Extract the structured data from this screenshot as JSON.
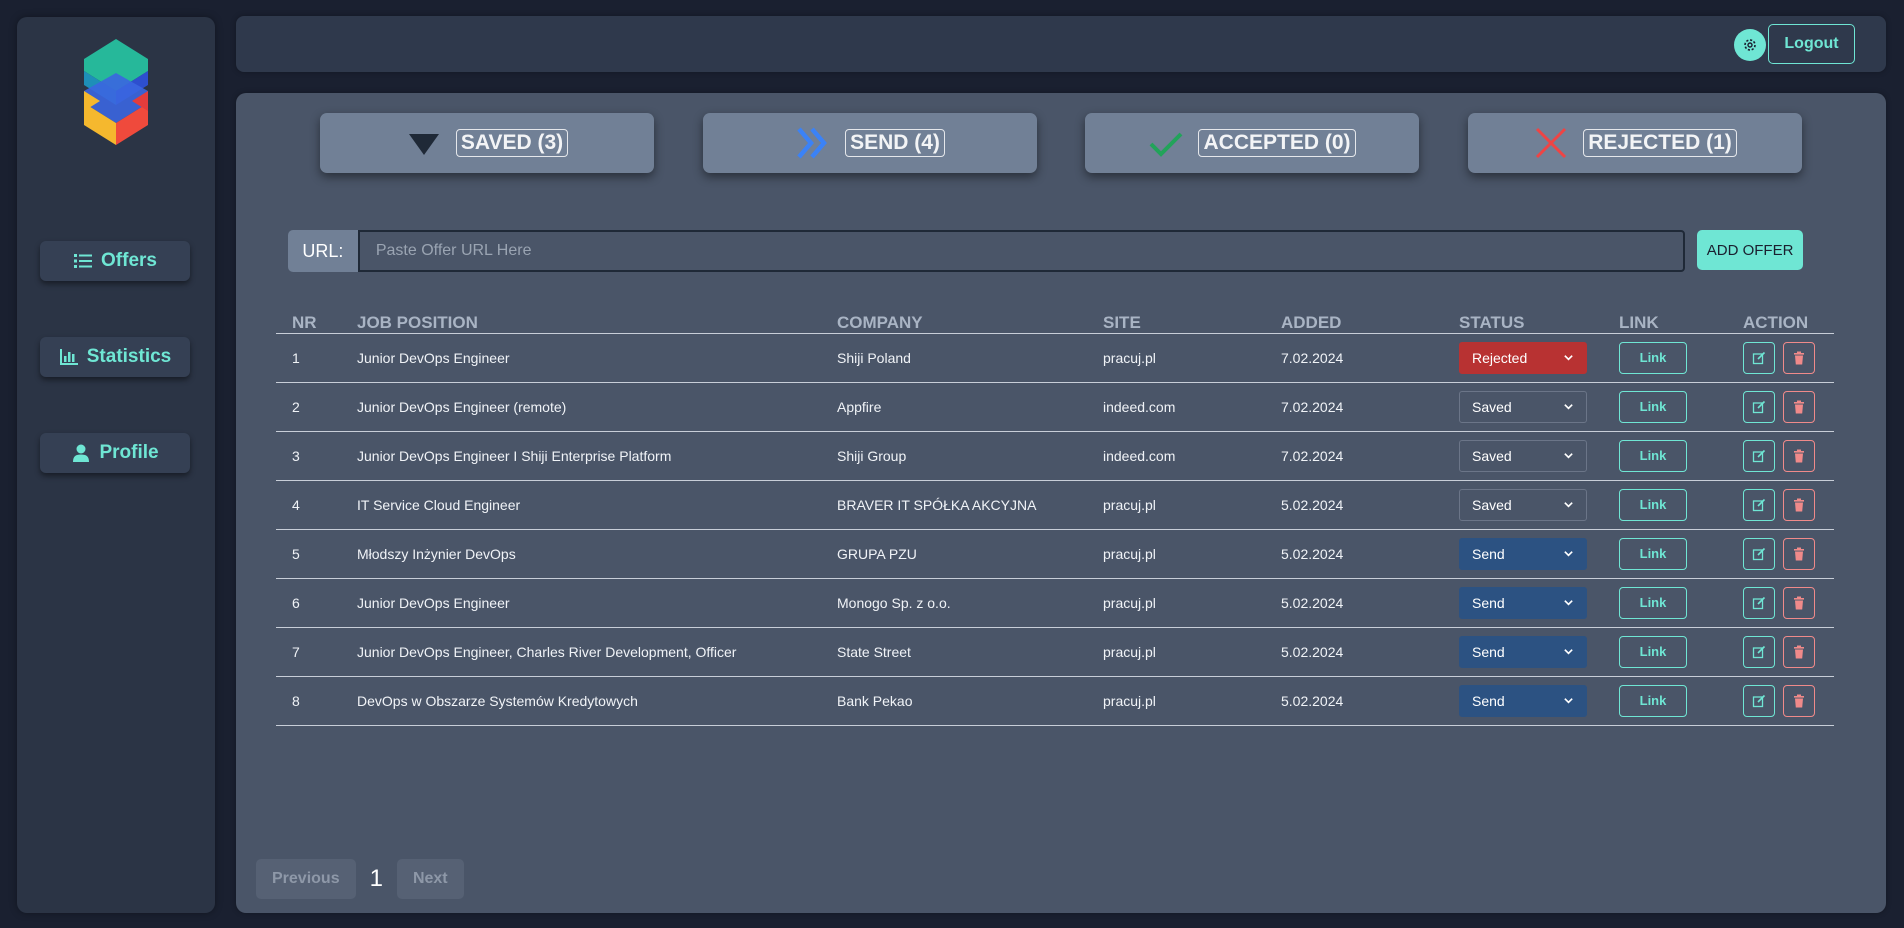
{
  "sidebar": {
    "items": [
      {
        "label": "Offers",
        "icon": "list-icon"
      },
      {
        "label": "Statistics",
        "icon": "bar-chart-icon"
      },
      {
        "label": "Profile",
        "icon": "user-icon"
      }
    ]
  },
  "header": {
    "logout_label": "Logout",
    "settings_icon": "gear-icon"
  },
  "stats": [
    {
      "label": "SAVED (3)",
      "icon": "triangle-down-icon",
      "color": "#1f2937"
    },
    {
      "label": "SEND (4)",
      "icon": "double-chevron-right-icon",
      "color": "#3b82f6"
    },
    {
      "label": "ACCEPTED (0)",
      "icon": "check-icon",
      "color": "#22a35a"
    },
    {
      "label": "REJECTED (1)",
      "icon": "x-icon",
      "color": "#ef4444"
    }
  ],
  "url_form": {
    "label": "URL:",
    "placeholder": "Paste Offer URL Here",
    "value": "",
    "add_label": "ADD OFFER"
  },
  "table": {
    "headers": [
      "NR",
      "JOB POSITION",
      "COMPANY",
      "SITE",
      "ADDED",
      "STATUS",
      "LINK",
      "ACTION"
    ],
    "rows": [
      {
        "nr": "1",
        "position": "Junior DevOps Engineer",
        "company": "Shiji Poland",
        "site": "pracuj.pl",
        "added": "7.02.2024",
        "status": "Rejected",
        "link": "Link"
      },
      {
        "nr": "2",
        "position": "Junior DevOps Engineer (remote)",
        "company": "Appfire",
        "site": "indeed.com",
        "added": "7.02.2024",
        "status": "Saved",
        "link": "Link"
      },
      {
        "nr": "3",
        "position": "Junior DevOps Engineer I Shiji Enterprise Platform",
        "company": "Shiji Group",
        "site": "indeed.com",
        "added": "7.02.2024",
        "status": "Saved",
        "link": "Link"
      },
      {
        "nr": "4",
        "position": "IT Service Cloud Engineer",
        "company": "BRAVER IT SPÓŁKA AKCYJNA",
        "site": "pracuj.pl",
        "added": "5.02.2024",
        "status": "Saved",
        "link": "Link"
      },
      {
        "nr": "5",
        "position": "Młodszy Inżynier DevOps",
        "company": "GRUPA PZU",
        "site": "pracuj.pl",
        "added": "5.02.2024",
        "status": "Send",
        "link": "Link"
      },
      {
        "nr": "6",
        "position": "Junior DevOps Engineer",
        "company": "Monogo Sp. z o.o.",
        "site": "pracuj.pl",
        "added": "5.02.2024",
        "status": "Send",
        "link": "Link"
      },
      {
        "nr": "7",
        "position": "Junior DevOps Engineer, Charles River Development, Officer",
        "company": "State Street",
        "site": "pracuj.pl",
        "added": "5.02.2024",
        "status": "Send",
        "link": "Link"
      },
      {
        "nr": "8",
        "position": "DevOps w Obszarze Systemów Kredytowych",
        "company": "Bank Pekao",
        "site": "pracuj.pl",
        "added": "5.02.2024",
        "status": "Send",
        "link": "Link"
      }
    ]
  },
  "pagination": {
    "previous_label": "Previous",
    "page": "1",
    "next_label": "Next"
  }
}
